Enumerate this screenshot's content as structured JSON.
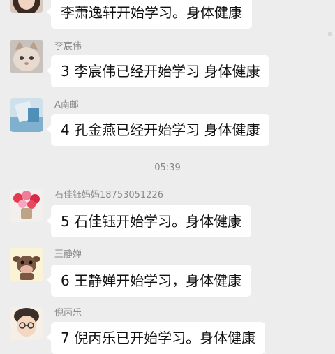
{
  "messages": [
    {
      "sender": "",
      "text": "李萧逸轩开始学习。身体健康",
      "avatar": "woman-portrait"
    },
    {
      "sender": "李宸伟",
      "text": "3 李宸伟已经开始学习 身体健康",
      "avatar": "kitten"
    },
    {
      "sender": "A南邮",
      "text": "4 孔金燕已经开始学习 身体健康",
      "avatar": "blue-photo"
    },
    {
      "sender": "石佳钰妈妈18753051226",
      "text": "5 石佳钰开始学习。身体健康",
      "avatar": "flower-bouquet"
    },
    {
      "sender": "王静婵",
      "text": "6 王静婵开始学习，身体健康",
      "avatar": "cartoon-cow"
    },
    {
      "sender": "倪丙乐",
      "text": "7 倪丙乐已开始学习。身体健康",
      "avatar": "cartoon-boy"
    }
  ],
  "timestamp": "05:39",
  "colors": {
    "background": "#ededed",
    "bubble": "#ffffff",
    "meta_text": "#8a8a8a"
  }
}
